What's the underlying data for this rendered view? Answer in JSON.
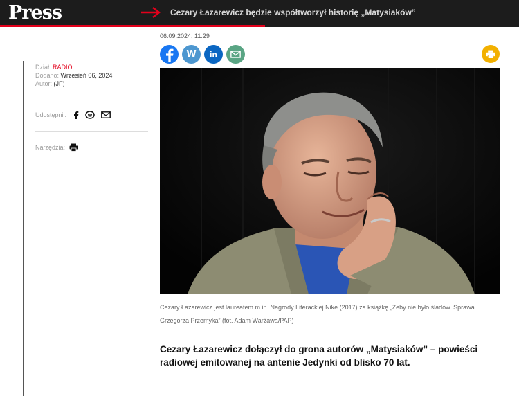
{
  "header": {
    "logo": "Press",
    "headline": "Cezary Łazarewicz będzie współtworzył historię „Matysiaków”",
    "accent_color": "#e3001b",
    "progress": 0.51
  },
  "article_meta": {
    "section_label": "Dział:",
    "section_value": "RADIO",
    "added_label": "Dodano:",
    "added_value": "Wrzesień 06, 2024",
    "author_label": "Autor:",
    "author_value": "(JF)",
    "share_label": "Udostępnij:",
    "tools_label": "Narzędzia:"
  },
  "article": {
    "datetime": "06.09.2024, 11:29",
    "social_buttons": [
      {
        "icon": "facebook-icon",
        "glyph": "f",
        "color": "#1877f2"
      },
      {
        "icon": "wykop-icon",
        "glyph": "W",
        "color": "#4d97d0"
      },
      {
        "icon": "linkedin-icon",
        "glyph": "in",
        "color": "#0a66c2"
      },
      {
        "icon": "mail-icon",
        "glyph": "",
        "color": "#5aa584"
      }
    ],
    "print_color": "#f2b000",
    "caption": "Cezary Łazarewicz jest laureatem m.in. Nagrody Literackiej Nike (2017) za książkę „Żeby nie było śladów. Sprawa Grzegorza Przemyka” (fot. Adam Warżawa/PAP)",
    "lead": "Cezary Łazarewicz dołączył do grona autorów „Matysiaków” – powieści radiowej emitowanej na antenie Jedynki od blisko 70 lat."
  }
}
